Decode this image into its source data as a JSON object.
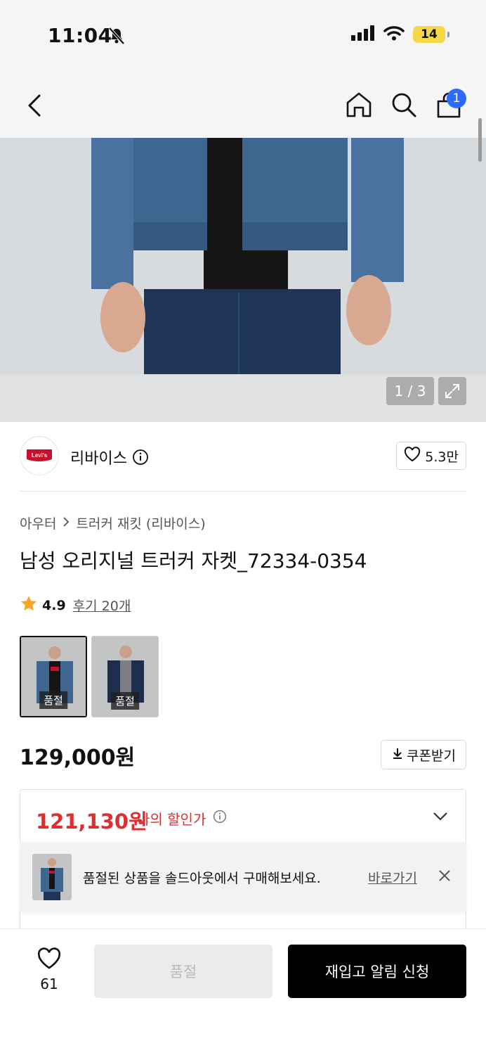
{
  "status": {
    "time": "11:04",
    "battery": "14"
  },
  "nav": {
    "cart_count": "1"
  },
  "gallery": {
    "counter": "1 / 3"
  },
  "brand": {
    "logo_text": "Levi's",
    "name": "리바이스",
    "likes": "5.3만"
  },
  "breadcrumb": {
    "category": "아우터",
    "subcategory": "트러커 재킷 (리바이스)"
  },
  "product": {
    "title": "남성 오리지널 트러커 자켓_72334-0354",
    "rating": "4.9",
    "reviews": "후기 20개",
    "price": "129,000원",
    "coupon_label": "쿠폰받기"
  },
  "variants": [
    {
      "tag": "품절"
    },
    {
      "tag": "품절"
    }
  ],
  "discount": {
    "price": "121,130원",
    "label": "나의 할인가"
  },
  "toast": {
    "message": "품절된 상품을 솔드아웃에서 구매해보세요.",
    "link": "바로가기"
  },
  "bottom": {
    "wish_count": "61",
    "soldout_label": "품절",
    "restock_label": "재입고 알림 신청"
  },
  "colors": {
    "accent_red": "#e02d2d",
    "badge_blue": "#2d6bff",
    "star": "#f5a623",
    "battery": "#f6d74a"
  }
}
